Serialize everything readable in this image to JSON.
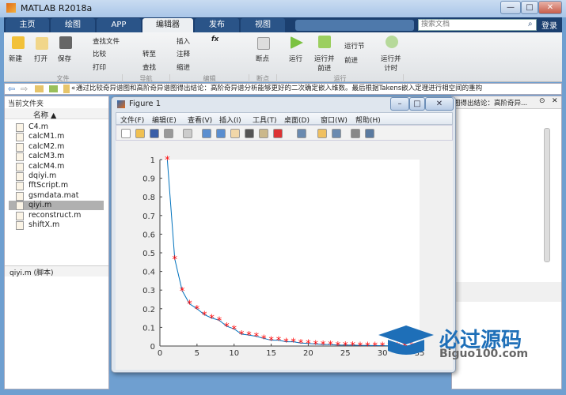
{
  "window": {
    "title": "MATLAB R2018a",
    "min": "—",
    "max": "□",
    "close": "✕"
  },
  "tabs": [
    "主页",
    "绘图",
    "APP",
    "编辑器",
    "发布",
    "视图"
  ],
  "search": {
    "placeholder": "搜索文档",
    "icon": "search-icon"
  },
  "login": "登录",
  "ribbon": {
    "file": {
      "new": "新建",
      "open": "打开",
      "save": "保存",
      "find_files": "查找文件",
      "compare": "比较",
      "print": "打印",
      "section": "文件"
    },
    "nav": {
      "goto": "转至",
      "find": "查找",
      "section": "导航"
    },
    "edit": {
      "insert": "插入",
      "comment": "注释",
      "indent": "缩进",
      "fx": "fx",
      "section": "编辑"
    },
    "breakpoints": {
      "label": "断点",
      "section": "断点"
    },
    "run": {
      "run": "运行",
      "run_advance": "运行并\n前进",
      "run_section": "运行节",
      "advance": "前进",
      "run_time": "运行并\n计时",
      "section": "运行"
    }
  },
  "address": {
    "prefix": "«",
    "path": "通过比较奇异谱图和高阶奇异谱图得出结论：高阶奇异谱分析能够更好的二次确定嵌入维数。最后根据Takens嵌入定理进行相空间的重构"
  },
  "current_folder": {
    "title": "当前文件夹",
    "column": "名称 ▲",
    "files": [
      "C4.m",
      "calcM1.m",
      "calcM2.m",
      "calcM3.m",
      "calcM4.m",
      "dqiyi.m",
      "fftScript.m",
      "gsmdata.mat",
      "qiyi.m",
      "reconstruct.m",
      "shiftX.m"
    ],
    "selected": "qiyi.m",
    "details": "qiyi.m  (脚本)"
  },
  "editor": {
    "title": "图得出结论：高阶奇异..."
  },
  "figure": {
    "title": "Figure 1",
    "menu": [
      "文件(F)",
      "编辑(E)",
      "查看(V)",
      "插入(I)",
      "工具(T)",
      "桌面(D)",
      "窗口(W)",
      "帮助(H)"
    ]
  },
  "chart_data": {
    "type": "line",
    "title": "",
    "xlabel": "",
    "ylabel": "",
    "xlim": [
      0,
      35
    ],
    "ylim": [
      0,
      1
    ],
    "xticks": [
      0,
      5,
      10,
      15,
      20,
      25,
      30,
      35
    ],
    "yticks": [
      0,
      0.1,
      0.2,
      0.3,
      0.4,
      0.5,
      0.6,
      0.7,
      0.8,
      0.9,
      1
    ],
    "xtick_labels": [
      "0",
      "5",
      "10",
      "15",
      "20",
      "25",
      "30",
      "35"
    ],
    "ytick_labels": [
      "0",
      "0.1",
      "0.2",
      "0.3",
      "0.4",
      "0.5",
      "0.6",
      "0.7",
      "0.8",
      "0.9",
      "1"
    ],
    "line_color": "#0072bd",
    "marker": "*",
    "marker_color": "#ff0000",
    "x": [
      1,
      2,
      3,
      4,
      5,
      6,
      7,
      8,
      9,
      10,
      11,
      12,
      13,
      14,
      15,
      16,
      17,
      18,
      19,
      20,
      21,
      22,
      23,
      24,
      25,
      26,
      27,
      28,
      29,
      30,
      31,
      32,
      33,
      34
    ],
    "y": [
      1.0,
      0.467,
      0.297,
      0.226,
      0.2,
      0.168,
      0.15,
      0.138,
      0.106,
      0.092,
      0.064,
      0.059,
      0.052,
      0.041,
      0.031,
      0.031,
      0.023,
      0.023,
      0.016,
      0.014,
      0.011,
      0.008,
      0.008,
      0.005,
      0.005,
      0.005,
      0.003,
      0.003,
      0.002,
      0.002,
      0.001,
      0.001,
      0.001,
      0.001
    ]
  },
  "watermark": {
    "cn": "必过源码",
    "en": "Biguo100.com"
  }
}
